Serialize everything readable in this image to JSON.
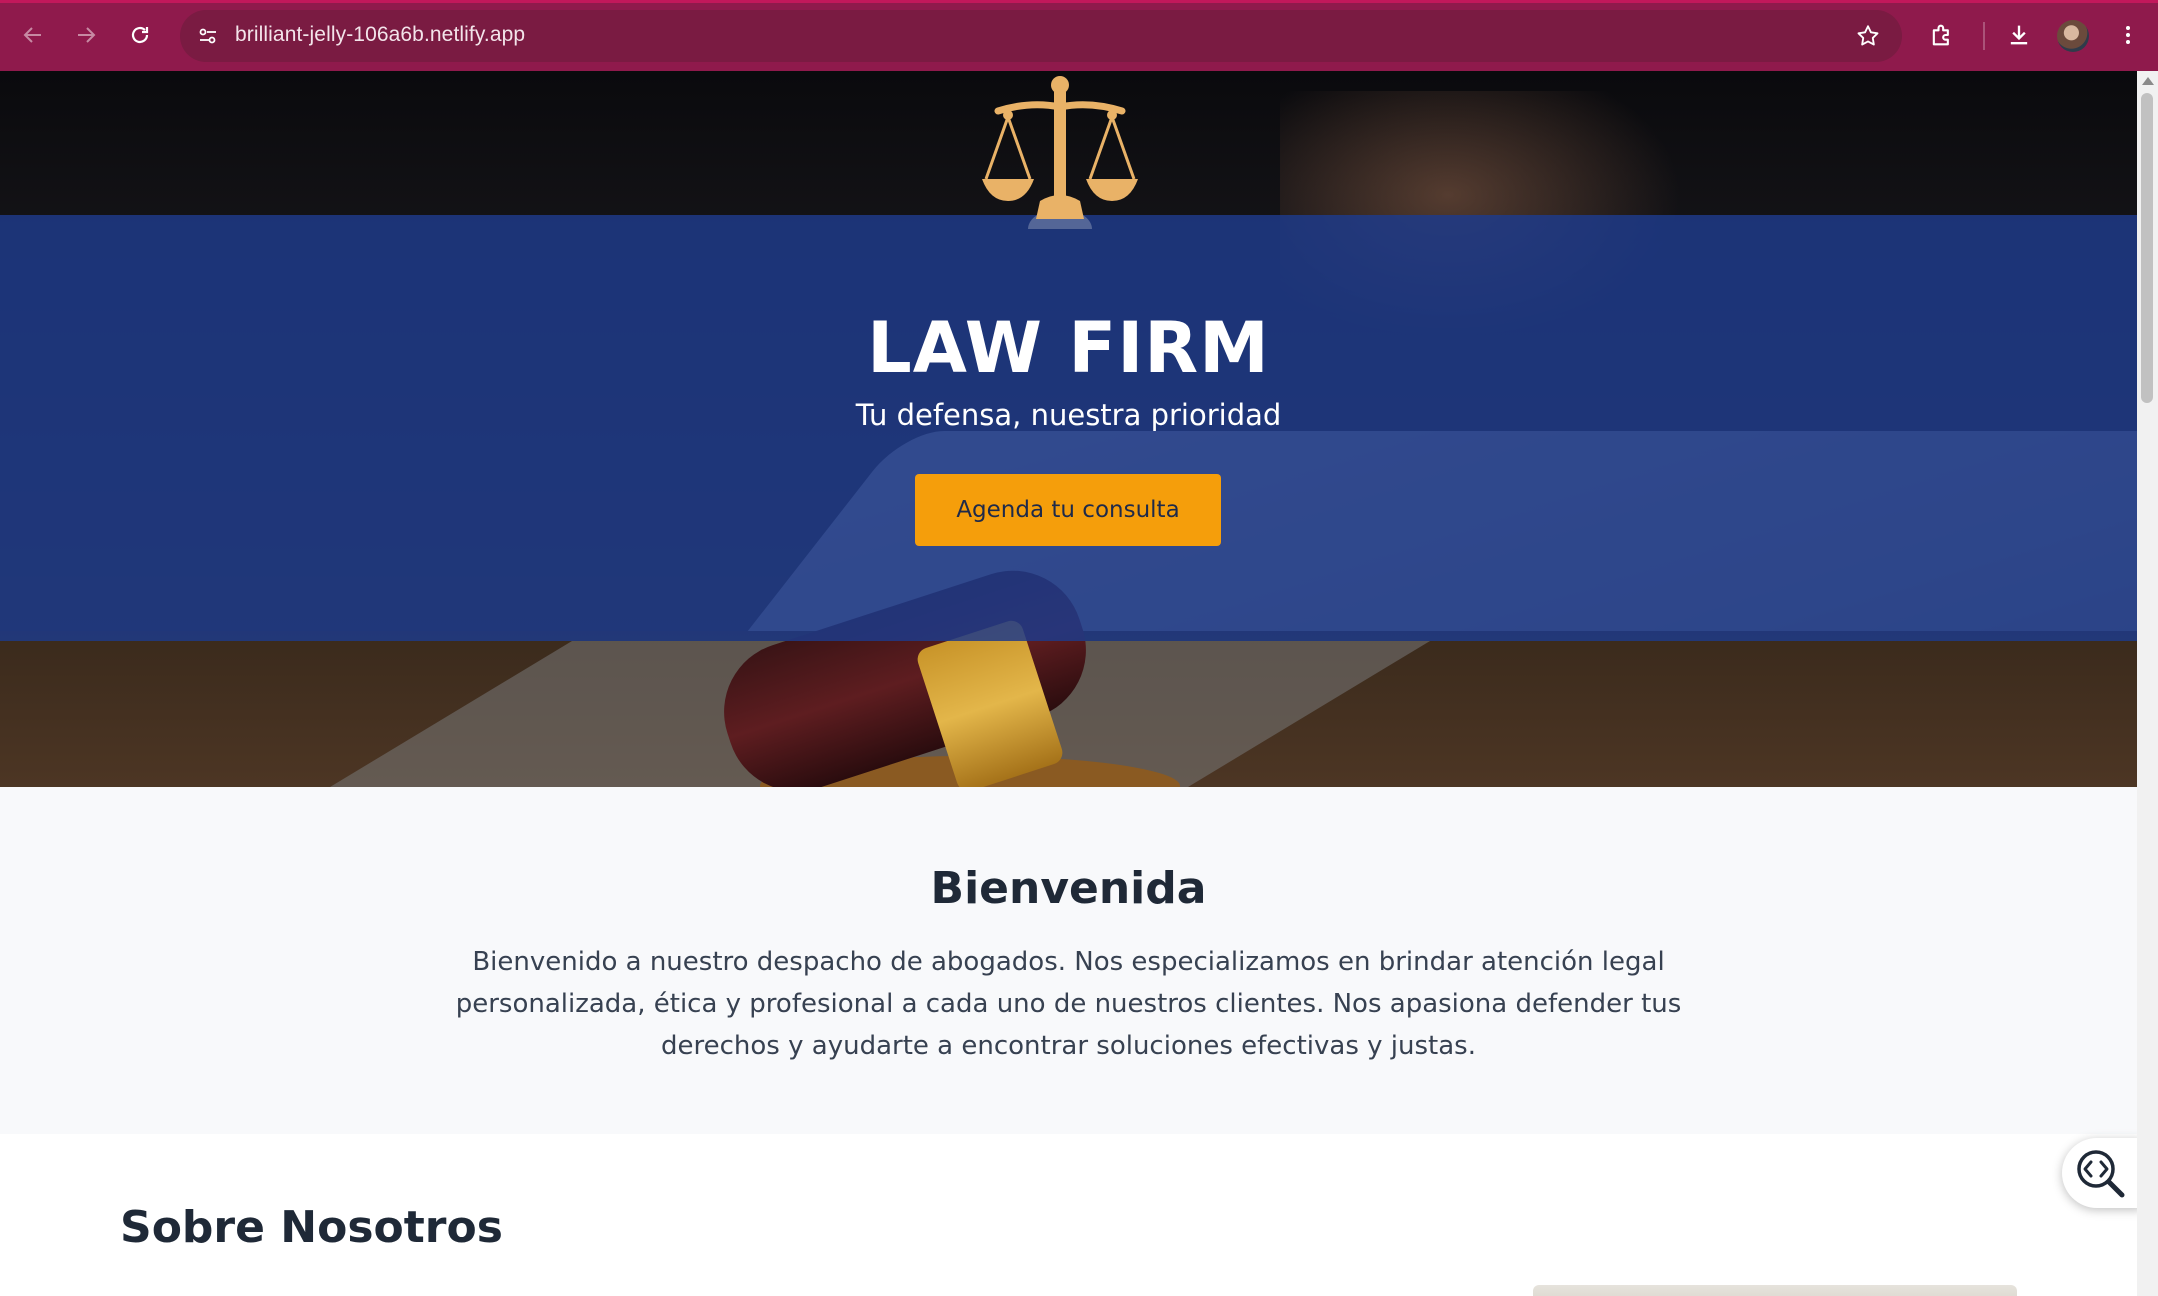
{
  "browser": {
    "url": "brilliant-jelly-106a6b.netlify.app",
    "icons": [
      "back-icon",
      "forward-icon",
      "reload-icon",
      "site-info-icon",
      "bookmark-star-icon",
      "extensions-icon",
      "download-icon",
      "profile-avatar",
      "menu-icon"
    ],
    "accent_color": "#8f1a4c"
  },
  "hero": {
    "logo": "scales-of-justice-icon",
    "title": "LAW FIRM",
    "subtitle": "Tu defensa, nuestra prioridad",
    "cta_label": "Agenda tu consulta",
    "band_color": "#1e3a8a",
    "cta_color": "#f59e0b"
  },
  "welcome": {
    "heading": "Bienvenida",
    "body": "Bienvenido a nuestro despacho de abogados. Nos especializamos en brindar atención legal personalizada, ética y profesional a cada uno de nuestros clientes. Nos apasiona defender tus derechos y ayudarte a encontrar soluciones efectivas y justas."
  },
  "about": {
    "heading": "Sobre Nosotros"
  },
  "floating_tool": {
    "icon": "code-inspect-icon"
  }
}
